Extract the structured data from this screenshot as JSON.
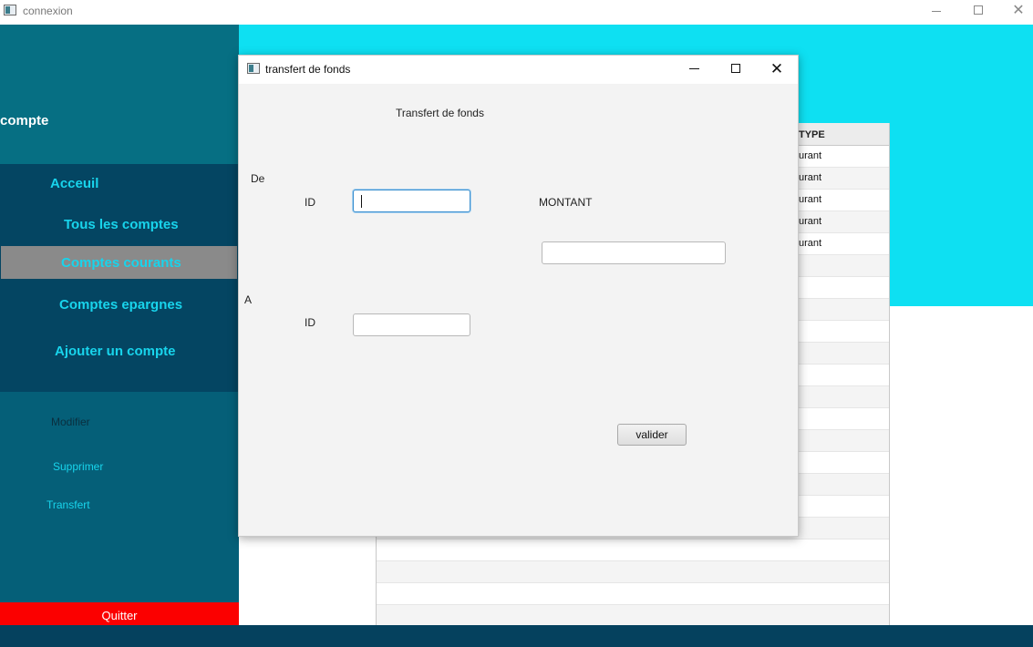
{
  "window": {
    "title": "connexion",
    "minimize_icon": "minimize-icon",
    "maximize_icon": "maximize-icon",
    "close_icon": "close-icon"
  },
  "sidebar": {
    "heading": "compte",
    "nav": [
      {
        "label": "Acceuil",
        "selected": false
      },
      {
        "label": "Tous les comptes",
        "selected": false
      },
      {
        "label": "Comptes courants",
        "selected": true
      },
      {
        "label": "Comptes epargnes",
        "selected": false
      },
      {
        "label": "Ajouter un compte",
        "selected": false
      }
    ],
    "actions": [
      {
        "label": "Modifier",
        "color": "#0a2f3f"
      },
      {
        "label": "Supprimer",
        "color": "#18d4ec"
      },
      {
        "label": "Transfert",
        "color": "#18d4ec"
      }
    ],
    "quit_label": "Quitter"
  },
  "colors": {
    "sidebar_top": "#066f83",
    "sidebar_nav": "#044562",
    "nav_text": "#18d4ec",
    "selected_bg": "#8a8a8a",
    "cyan_header": "#0ee0f2",
    "quit_bg": "#fb0000",
    "bottom_bar": "#05415e"
  },
  "table": {
    "columns": [
      "TYPE"
    ],
    "rows": [
      "urant",
      "urant",
      "urant",
      "urant",
      "urant"
    ]
  },
  "dialog": {
    "title": "transfert de fonds",
    "heading": "Transfert de fonds",
    "from_label": "De",
    "from_id_label": "ID",
    "from_id_value": "",
    "amount_label": "MONTANT",
    "amount_value": "",
    "to_label": "A",
    "to_id_label": "ID",
    "to_id_value": "",
    "submit_label": "valider"
  }
}
